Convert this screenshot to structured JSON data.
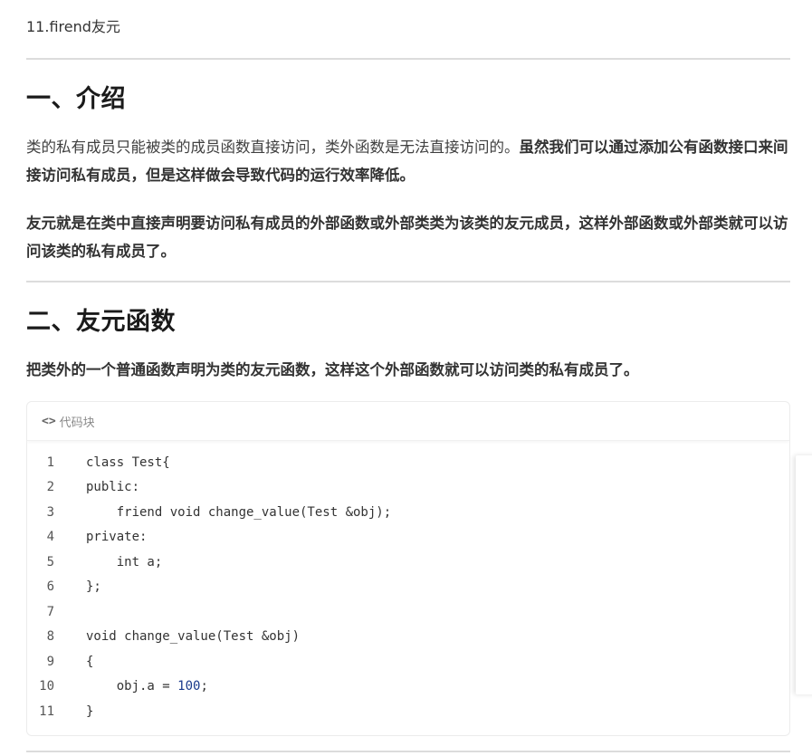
{
  "doc": {
    "title": "11.firend友元"
  },
  "sections": [
    {
      "heading": "一、介绍",
      "p1_plain": "类的私有成员只能被类的成员函数直接访问，类外函数是无法直接访问的。",
      "p1_bold": "虽然我们可以通过添加公有函数接口来间接访问私有成员，但是这样做会导致代码的运行效率降低。",
      "p2_bold": "友元就是在类中直接声明要访问私有成员的外部函数或外部类类为该类的友元成员，这样外部函数或外部类就可以访问该类的私有成员了。"
    },
    {
      "heading": "二、友元函数",
      "p1_bold": "把类外的一个普通函数声明为类的友元函数，这样这个外部函数就可以访问类的私有成员了。"
    }
  ],
  "code_block": {
    "header_label": "代码块",
    "lines": [
      {
        "n": "1",
        "code": "class Test{"
      },
      {
        "n": "2",
        "code": "public:"
      },
      {
        "n": "3",
        "code": "    friend void change_value(Test &obj);"
      },
      {
        "n": "4",
        "code": "private:"
      },
      {
        "n": "5",
        "code": "    int a;"
      },
      {
        "n": "6",
        "code": "};"
      },
      {
        "n": "7",
        "code": ""
      },
      {
        "n": "8",
        "code": "void change_value(Test &obj)"
      },
      {
        "n": "9",
        "code": "{"
      },
      {
        "n": "10",
        "code_pre": "    obj.a = ",
        "code_num": "100",
        "code_post": ";"
      },
      {
        "n": "11",
        "code": "}"
      }
    ]
  }
}
